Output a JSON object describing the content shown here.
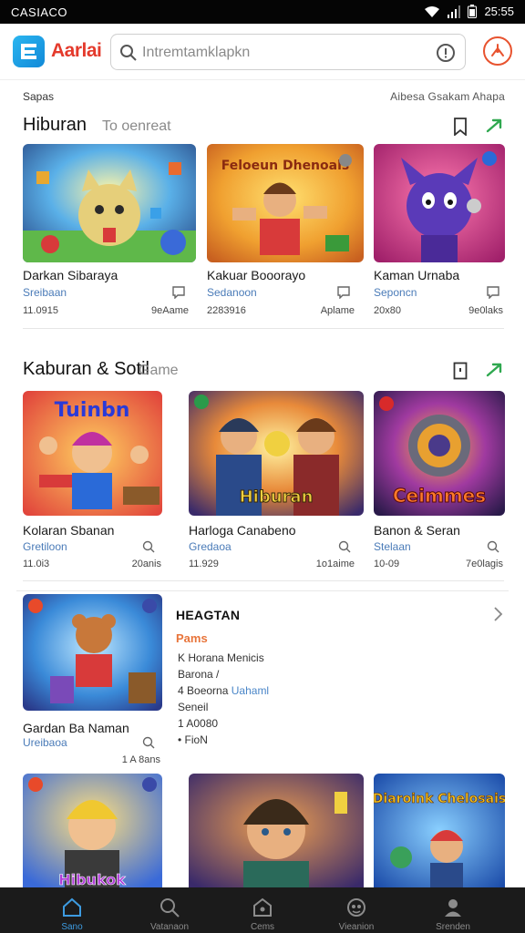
{
  "status_bar": {
    "carrier": "CASIACO",
    "time": "25:55"
  },
  "header": {
    "app_name": "Aarlai",
    "search_placeholder": "Intremtamklapkn"
  },
  "subnav": {
    "left": "Sapas",
    "right": "Aibesa  Gsakam  Ahapa"
  },
  "sections": [
    {
      "title": "Hiburan",
      "subtitle": "To oenreat",
      "cards": [
        {
          "name": "Darkan Sibaraya",
          "tag": "Sreibaan",
          "count": "11.0915",
          "meta": "9eAame"
        },
        {
          "name": "Kakuar Booorayo",
          "tag": "Sedanoon",
          "count": "2283916",
          "meta": "Aplame"
        },
        {
          "name": "Kaman Urnaba",
          "tag": "Seponcn",
          "count": "20x80",
          "meta": "9e0laks"
        }
      ]
    },
    {
      "title": "Kaburan & Sotil",
      "subtitle": "Game",
      "cards": [
        {
          "name": "Kolaran Sbanan",
          "tag": "Gretiloon",
          "count": "11.0i3",
          "meta": "20anis"
        },
        {
          "name": "Harloga Canabeno",
          "tag": "Gredaoa",
          "count": "11.929",
          "meta": "1o1aime"
        },
        {
          "name": "Banon & Seran",
          "tag": "Stelaan",
          "count": "10-09",
          "meta": "7e0lagis"
        }
      ]
    }
  ],
  "featured": {
    "card": {
      "name": "Gardan Ba Naman",
      "tag": "Ureibaoa",
      "meta": "1 A 8ans"
    },
    "title": "HEAGTAN",
    "label": "Pams",
    "lines": [
      {
        "text": "Horana Menicis",
        "prefix": "K"
      },
      {
        "text": "Barona  /",
        "prefix": ""
      },
      {
        "text": "Boeorna",
        "link": "Uahaml",
        "prefix": "4"
      },
      {
        "text": "Seneil",
        "prefix": ""
      },
      {
        "text": "A0080",
        "prefix": "1"
      },
      {
        "text": "FioN",
        "prefix": "•"
      }
    ]
  },
  "bottom_row_thumbs": [
    "Hibukok",
    "",
    "Diaroink Chelosais"
  ],
  "thumb_texts": {
    "s1c2": "Feloeun Dhenoals",
    "s2c1": "Tuinbn",
    "s2c2": "Hiburan",
    "s2c3": "Ceimmes"
  },
  "bottom_nav": [
    {
      "label": "Sano",
      "icon": "home-icon",
      "active": true
    },
    {
      "label": "Vatanaon",
      "icon": "search-icon",
      "active": false
    },
    {
      "label": "Cems",
      "icon": "shield-home-icon",
      "active": false
    },
    {
      "label": "Vieanion",
      "icon": "gamepad-icon",
      "active": false
    },
    {
      "label": "Srenden",
      "icon": "profile-icon",
      "active": false
    }
  ],
  "colors": {
    "accent": "#e43a2c",
    "link": "#4a7bb8",
    "active_nav": "#3d9be0",
    "green_arrow": "#2fa84f"
  }
}
